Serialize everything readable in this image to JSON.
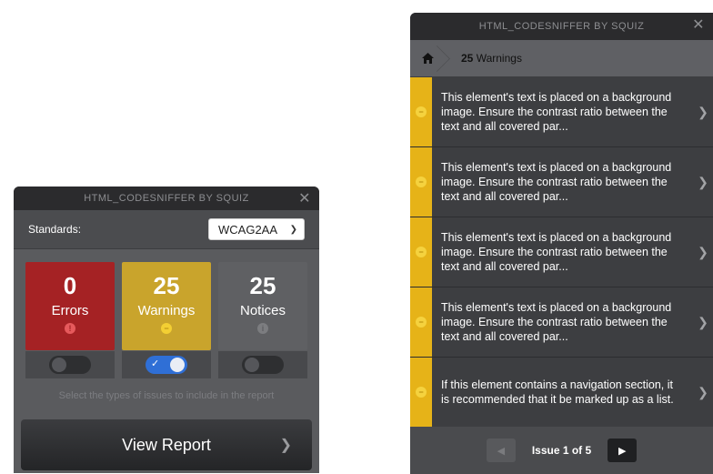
{
  "left_panel": {
    "title": "HTML_CODESNIFFER BY SQUIZ",
    "close_glyph": "✕",
    "standards_label": "Standards:",
    "standard_selected": "WCAG2AA",
    "counts": {
      "errors": {
        "count": "0",
        "label": "Errors",
        "icon": "!",
        "enabled": false
      },
      "warnings": {
        "count": "25",
        "label": "Warnings",
        "icon": "−",
        "enabled": true
      },
      "notices": {
        "count": "25",
        "label": "Notices",
        "icon": "i",
        "enabled": false
      }
    },
    "hint": "Select the types of issues to include in the report",
    "view_report_label": "View Report",
    "colors": {
      "errors": "#a52224",
      "warnings": "#c9a42c",
      "notices": "#5f6063",
      "toggle_on": "#2f6fd6"
    }
  },
  "right_panel": {
    "title": "HTML_CODESNIFFER BY SQUIZ",
    "close_glyph": "✕",
    "breadcrumb_count": "25",
    "breadcrumb_label": "Warnings",
    "issues": [
      {
        "text": "This element's text is placed on a background image. Ensure the contrast ratio between the text and all covered par..."
      },
      {
        "text": "This element's text is placed on a background image. Ensure the contrast ratio between the text and all covered par..."
      },
      {
        "text": "This element's text is placed on a background image. Ensure the contrast ratio between the text and all covered par..."
      },
      {
        "text": "This element's text is placed on a background image. Ensure the contrast ratio between the text and all covered par..."
      },
      {
        "text": "If this element contains a navigation section, it is recommended that it be marked up as a list."
      }
    ],
    "pager_text": "Issue 1 of 5",
    "colors": {
      "warning_stripe": "#e6b318"
    }
  }
}
